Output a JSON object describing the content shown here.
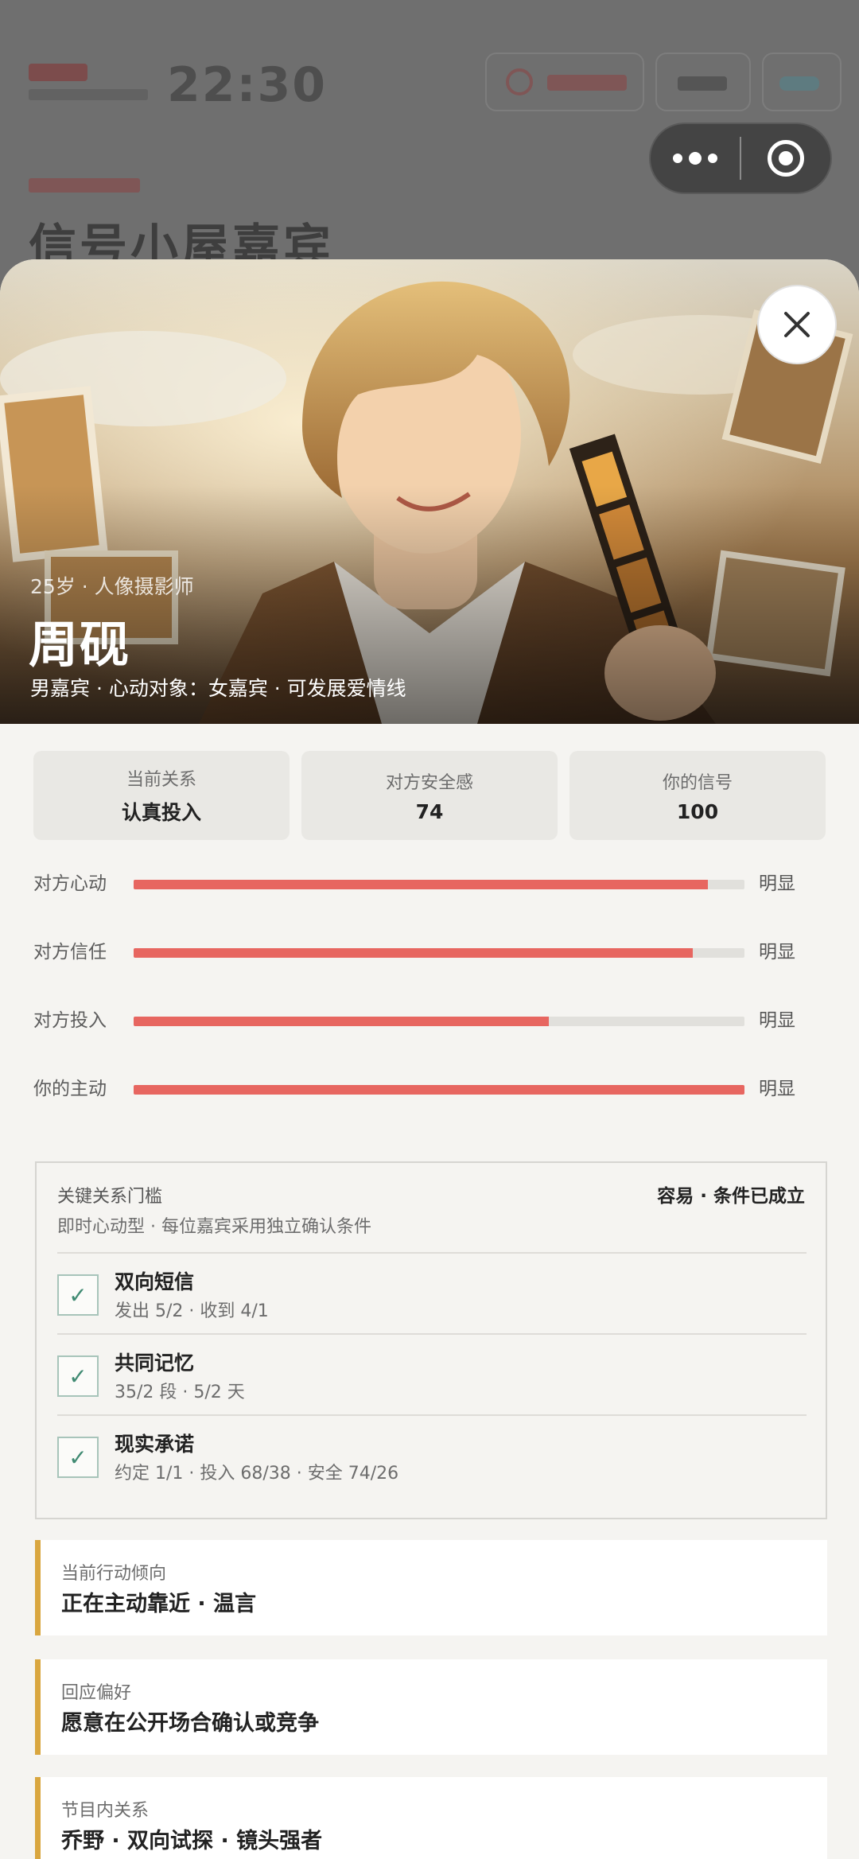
{
  "background": {
    "clock": "22:30",
    "heading": "信号小屋嘉宾"
  },
  "profile": {
    "meta": "25岁 · 人像摄影师",
    "name": "周砚",
    "subtitle": "男嘉宾 · 心动对象：女嘉宾 · 可发展爱情线"
  },
  "stats": [
    {
      "label": "当前关系",
      "value": "认真投入"
    },
    {
      "label": "对方安全感",
      "value": "74"
    },
    {
      "label": "你的信号",
      "value": "100"
    }
  ],
  "bars": [
    {
      "label": "对方心动",
      "level": 0.94,
      "tag": "明显"
    },
    {
      "label": "对方信任",
      "level": 0.915,
      "tag": "明显"
    },
    {
      "label": "对方投入",
      "level": 0.68,
      "tag": "明显"
    },
    {
      "label": "你的主动",
      "level": 1.0,
      "tag": "明显"
    }
  ],
  "threshold": {
    "title": "关键关系门槛",
    "status": "容易 · 条件已成立",
    "description": "即时心动型 · 每位嘉宾采用独立确认条件",
    "items": [
      {
        "name": "双向短信",
        "detail": "发出 5/2 · 收到 4/1",
        "checked": true
      },
      {
        "name": "共同记忆",
        "detail": "35/2 段 · 5/2 天",
        "checked": true
      },
      {
        "name": "现实承诺",
        "detail": "约定 1/1 · 投入 68/38 · 安全 74/26",
        "checked": true
      }
    ]
  },
  "info_cards": [
    {
      "label": "当前行动倾向",
      "value": "正在主动靠近 · 温言"
    },
    {
      "label": "回应偏好",
      "value": "愿意在公开场合确认或竞争"
    },
    {
      "label": "节目内关系",
      "value": "乔野 · 双向试探 · 镜头强者"
    }
  ],
  "colors": {
    "bar_fill": "#e76660",
    "accent_border": "#d9a63f",
    "check": "#3f8a72"
  },
  "icons": {
    "close": "close-icon",
    "check": "check-icon",
    "capsule_more": "more-dots-icon",
    "capsule_exit": "target-icon"
  }
}
